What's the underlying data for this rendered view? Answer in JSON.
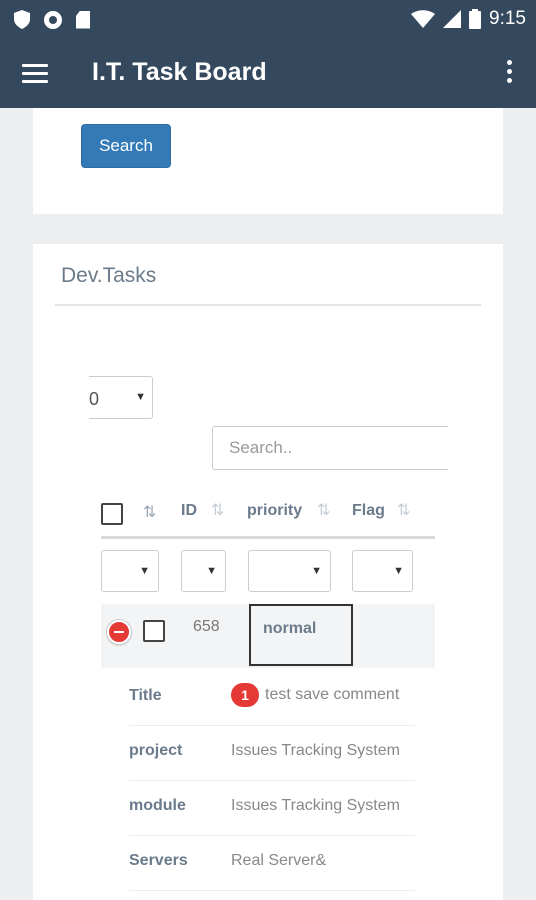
{
  "status_bar": {
    "time": "9:15"
  },
  "app_bar": {
    "title": "I.T. Task Board"
  },
  "search_card": {
    "search_button": "Search"
  },
  "dev_tasks": {
    "title": "Dev.Tasks",
    "page_length_value": "0",
    "table_search_placeholder": "Search..",
    "columns": [
      "ID",
      "priority",
      "Flag"
    ],
    "row": {
      "id": "658",
      "priority": "normal"
    },
    "details": [
      {
        "label": "Title",
        "badge": "1",
        "value": "test save comment"
      },
      {
        "label": "project",
        "value": "Issues Tracking System"
      },
      {
        "label": "module",
        "value": "Issues Tracking System"
      },
      {
        "label": "Servers",
        "value": "Real Server&"
      }
    ]
  },
  "colors": {
    "app_bar": "#34495e",
    "primary_button": "#337ab7",
    "danger": "#e53935"
  }
}
